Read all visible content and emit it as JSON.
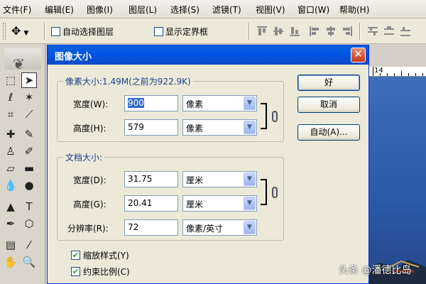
{
  "menubar": {
    "items": [
      "文件(F)",
      "编辑(E)",
      "图像(I)",
      "图层(L)",
      "选择(S)",
      "滤镜(T)",
      "视图(V)",
      "窗口(W)",
      "帮助(H)"
    ]
  },
  "options": {
    "auto_select_layer": {
      "label": "自动选择图层",
      "checked": false
    },
    "show_bounding_box": {
      "label": "显示定界框",
      "checked": false
    }
  },
  "image": {
    "ruler_label": "14"
  },
  "dialog": {
    "title": "图像大小",
    "close_glyph": "✕",
    "pixel_dimensions": {
      "legend": "像素大小:1.49M(之前为922.9K)",
      "width_label": "宽度(W):",
      "width_value": "900",
      "width_unit": "像素",
      "height_label": "高度(H):",
      "height_value": "579",
      "height_unit": "像素"
    },
    "document_size": {
      "legend": "文档大小:",
      "width_label": "宽度(D):",
      "width_value": "31.75",
      "width_unit": "厘米",
      "height_label": "高度(G):",
      "height_value": "20.41",
      "height_unit": "厘米",
      "resolution_label": "分辨率(R):",
      "resolution_value": "72",
      "resolution_unit": "像素/英寸"
    },
    "buttons": {
      "ok": "好",
      "cancel": "取消",
      "auto": "自动(A)..."
    },
    "scale_styles": {
      "label": "缩放样式(Y)",
      "checked": true
    },
    "constrain_proportions": {
      "label": "约束比例(C)",
      "checked": true
    }
  },
  "watermark": "头条 @潘德比岛",
  "colors": {
    "title_blue": "#0055e5",
    "legend_blue": "#1c3e8a",
    "check_green": "#21a121"
  }
}
